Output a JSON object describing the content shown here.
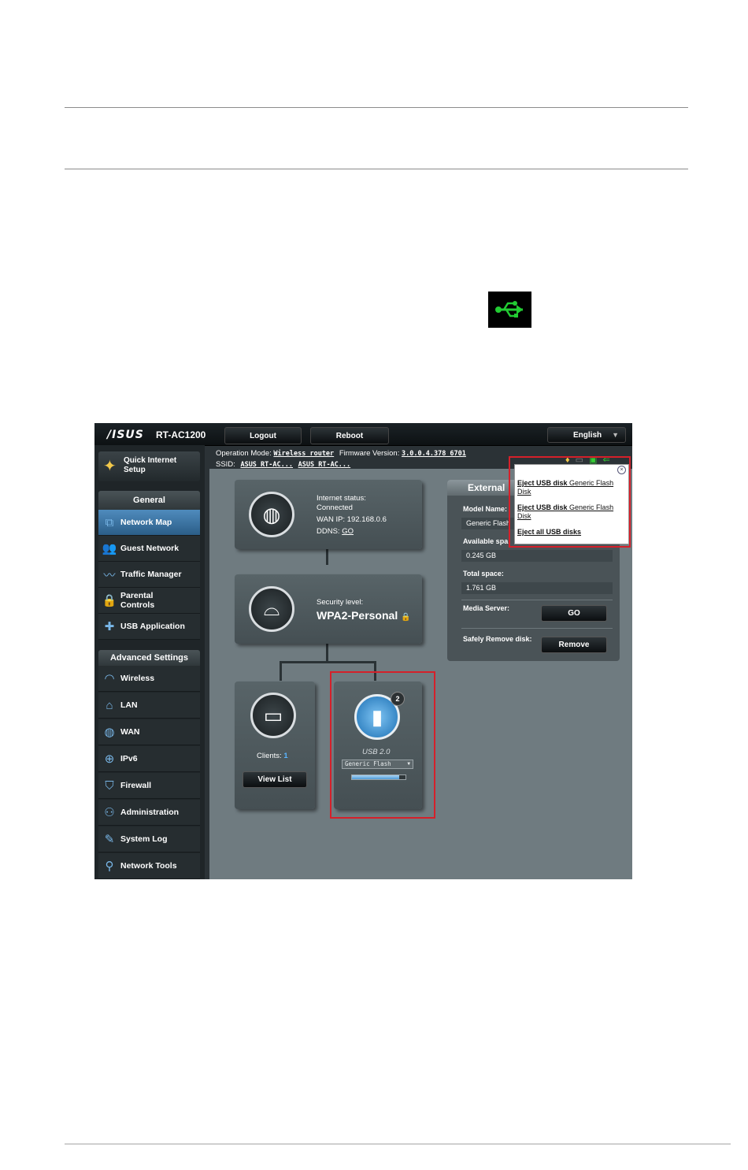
{
  "tray_icon": {
    "name": "usb-icon",
    "color": "#22cc33"
  },
  "router": {
    "brand": "/ISUS",
    "model": "RT-AC1200",
    "top_buttons": {
      "logout": "Logout",
      "reboot": "Reboot",
      "language": "English"
    },
    "operation_mode_label": "Operation Mode:",
    "operation_mode_value": "Wireless router",
    "firmware_label": "Firmware Version:",
    "firmware_value": "3.0.0.4.378_6701",
    "ssid_label": "SSID:",
    "ssid_values": [
      "ASUS_RT-AC...",
      "ASUS_RT-AC..."
    ],
    "sidebar": {
      "quick_setup": "Quick Internet Setup",
      "general_header": "General",
      "general_items": [
        {
          "label": "Network Map",
          "icon": "network-map-icon",
          "active": true
        },
        {
          "label": "Guest Network",
          "icon": "guest-network-icon"
        },
        {
          "label": "Traffic Manager",
          "icon": "traffic-manager-icon"
        },
        {
          "label": "Parental Controls",
          "icon": "lock-icon"
        },
        {
          "label": "USB Application",
          "icon": "puzzle-icon"
        }
      ],
      "advanced_header": "Advanced Settings",
      "advanced_items": [
        {
          "label": "Wireless",
          "icon": "wifi-icon"
        },
        {
          "label": "LAN",
          "icon": "home-icon"
        },
        {
          "label": "WAN",
          "icon": "globe-icon"
        },
        {
          "label": "IPv6",
          "icon": "ipv6-icon"
        },
        {
          "label": "Firewall",
          "icon": "shield-icon"
        },
        {
          "label": "Administration",
          "icon": "person-icon"
        },
        {
          "label": "System Log",
          "icon": "log-icon"
        },
        {
          "label": "Network Tools",
          "icon": "tools-icon"
        }
      ]
    },
    "internet_card": {
      "status_label": "Internet status:",
      "status_value": "Connected",
      "wan_ip": "WAN IP: 192.168.0.6",
      "ddns_label": "DDNS:",
      "ddns_value": "GO"
    },
    "security_card": {
      "label": "Security level:",
      "value": "WPA2-Personal"
    },
    "clients_card": {
      "label": "Clients:",
      "count": "1",
      "button": "View List"
    },
    "usb_card": {
      "badge": "2",
      "label": "USB 2.0",
      "device_select": "Generic Flash",
      "usage_fraction": 0.88
    },
    "external_panel": {
      "title": "External",
      "model_label": "Model Name:",
      "model_value": "Generic Flash",
      "available_label": "Available spa",
      "available_value": "0.245 GB",
      "total_label": "Total space:",
      "total_value": "1.761 GB",
      "media_label": "Media Server:",
      "media_button": "GO",
      "remove_label": "Safely Remove disk:",
      "remove_button": "Remove"
    },
    "eject_popup": {
      "item1_bold": "Eject USB disk",
      "item1_rest": "Generic Flash Disk",
      "item2_bold": "Eject USB disk",
      "item2_rest": "Generic Flash Disk",
      "item3": "Eject all USB disks"
    },
    "highlight_color": "#d5202a"
  }
}
